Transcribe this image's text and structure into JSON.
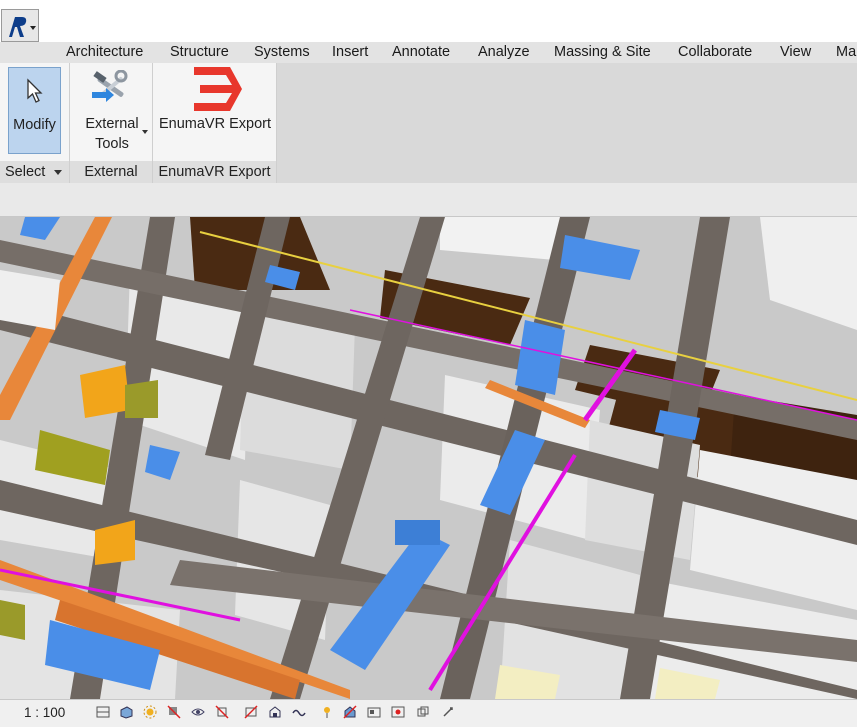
{
  "app": {
    "logo_icon": "revit-logo-icon"
  },
  "tabs": [
    "Architecture",
    "Structure",
    "Systems",
    "Insert",
    "Annotate",
    "Analyze",
    "Massing & Site",
    "Collaborate",
    "View",
    "Ma"
  ],
  "ribbon": {
    "modify": {
      "label": "Modify",
      "icon": "cursor-arrow-icon"
    },
    "external_tools": {
      "line1": "External",
      "line2": "Tools",
      "icon": "hammer-wrench-icon"
    },
    "enuma": {
      "label": "EnumaVR Export",
      "icon": "enumavr-logo-icon",
      "logo_color": "#e8372c"
    },
    "panels": [
      {
        "label": "Select",
        "has_dropdown": true
      },
      {
        "label": "External"
      },
      {
        "label": "EnumaVR Export"
      }
    ]
  },
  "status": {
    "scale": "1 : 100",
    "view_controls": [
      "detail-level-icon",
      "visual-style-icon",
      "sun-path-icon",
      "shadows-icon",
      "render-icon",
      "crop-view-icon",
      "show-crop-icon",
      "unlock-3d-icon",
      "temporary-hide-icon",
      "reveal-hidden-icon",
      "temporary-view-properties-icon",
      "worksharing-display-icon",
      "analytical-model-icon",
      "highlight-displacement-icon",
      "constraints-icon"
    ]
  },
  "colors": {
    "duct_blue": "#4a8ee8",
    "pipe_magenta": "#e010e0",
    "tray_orange": "#e8873a",
    "beam_gray": "#6e6660",
    "wall_white": "#efefef",
    "slab_brown": "#4a2a12"
  }
}
